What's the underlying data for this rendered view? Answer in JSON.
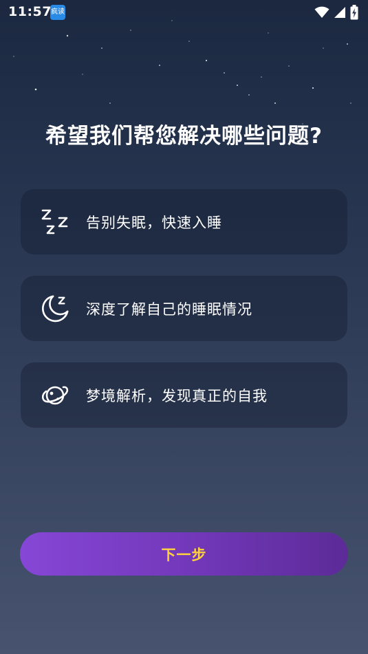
{
  "status_bar": {
    "time": "11:57",
    "app_badge": "疯读"
  },
  "headline": "希望我们帮您解决哪些问题?",
  "options": [
    {
      "icon": "sleep-zzz-icon",
      "label": "告别失眠，快速入睡"
    },
    {
      "icon": "moon-zzz-icon",
      "label": "深度了解自己的睡眠情况"
    },
    {
      "icon": "dream-planet-icon",
      "label": "梦境解析，发现真正的自我"
    }
  ],
  "next_button": {
    "label": "下一步"
  },
  "colors": {
    "background_top": "#1b2840",
    "background_bottom": "#47536f",
    "card_bg": "#263148",
    "button_gradient_start": "#8647d6",
    "button_gradient_end": "#5c2b97",
    "button_text": "#ffd33d"
  }
}
